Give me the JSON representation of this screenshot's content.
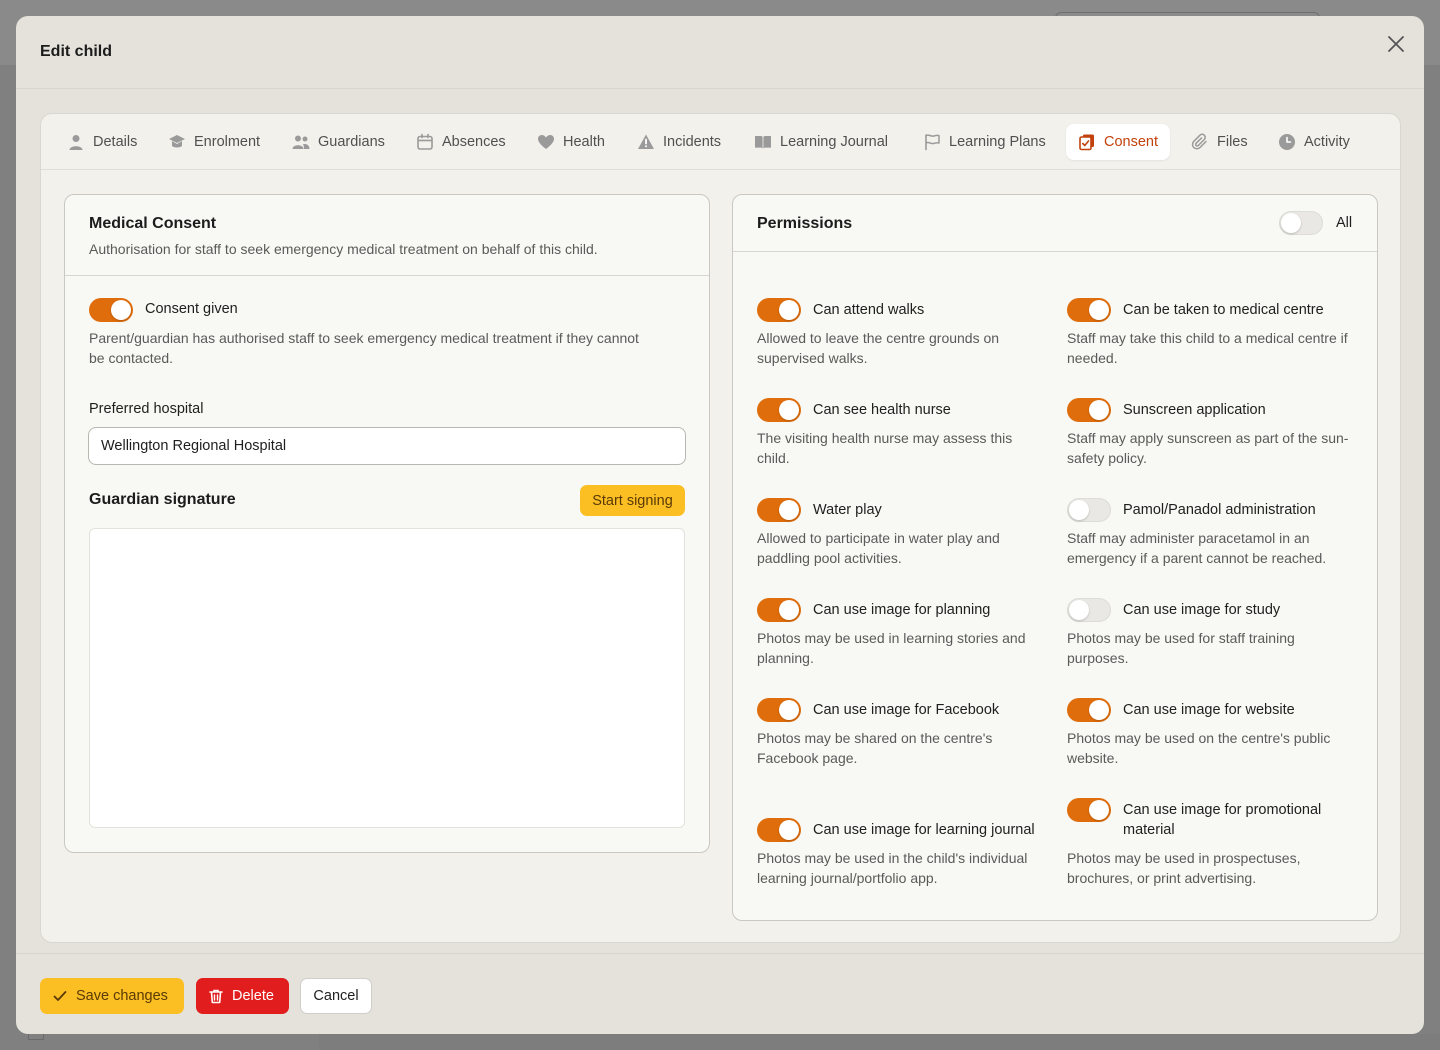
{
  "modal": {
    "title": "Edit child"
  },
  "tabs": [
    {
      "label": "Details",
      "icon": "user-icon"
    },
    {
      "label": "Enrolment",
      "icon": "graduation-cap-icon"
    },
    {
      "label": "Guardians",
      "icon": "users-icon"
    },
    {
      "label": "Absences",
      "icon": "calendar-icon"
    },
    {
      "label": "Health",
      "icon": "heart-icon"
    },
    {
      "label": "Incidents",
      "icon": "warning-triangle-icon"
    },
    {
      "label": "Learning Journal",
      "icon": "book-open-icon"
    },
    {
      "label": "Learning Plans",
      "icon": "flag-icon"
    },
    {
      "label": "Consent",
      "icon": "clipboard-check-icon",
      "active": true
    },
    {
      "label": "Files",
      "icon": "paperclip-icon"
    },
    {
      "label": "Activity",
      "icon": "clock-icon"
    }
  ],
  "medical": {
    "title": "Medical Consent",
    "subtitle": "Authorisation for staff to seek emergency medical treatment on behalf of this child.",
    "consent_label": "Consent given",
    "consent_on": true,
    "consent_desc_1": "Parent/guardian has authorised staff to seek emergency medical treatment if they cannot",
    "consent_desc_2": "be contacted.",
    "hospital_label": "Preferred hospital",
    "hospital_value": "Wellington Regional Hospital",
    "signature_title": "Guardian signature",
    "start_signing": "Start signing"
  },
  "permissions": {
    "title": "Permissions",
    "all_label": "All",
    "all_on": false,
    "items": [
      {
        "label": "Can attend walks",
        "desc": "Allowed to leave the centre grounds on supervised walks.",
        "on": true
      },
      {
        "label": "Can be taken to medical centre",
        "desc": "Staff may take this child to a medical centre if needed.",
        "on": true
      },
      {
        "label": "Can see health nurse",
        "desc": "The visiting health nurse may assess this child.",
        "on": true
      },
      {
        "label": "Sunscreen application",
        "desc": "Staff may apply sunscreen as part of the sun-safety policy.",
        "on": true
      },
      {
        "label": "Water play",
        "desc": "Allowed to participate in water play and paddling pool activities.",
        "on": true
      },
      {
        "label": "Pamol/Panadol administration",
        "desc": "Staff may administer paracetamol in an emergency if a parent cannot be reached.",
        "on": false
      },
      {
        "label": "Can use image for planning",
        "desc": "Photos may be used in learning stories and planning.",
        "on": true
      },
      {
        "label": "Can use image for study",
        "desc": "Photos may be used for staff training purposes.",
        "on": false
      },
      {
        "label": "Can use image for Facebook",
        "desc": "Photos may be shared on the centre's Facebook page.",
        "on": true
      },
      {
        "label": "Can use image for website",
        "desc": "Photos may be used on the centre's public website.",
        "on": true
      },
      {
        "label": "Can use image for learning journal",
        "desc": "Photos may be used in the child's individual learning journal/portfolio app.",
        "on": true
      },
      {
        "label": "Can use image for promotional material",
        "desc": "Photos may be used in prospectuses, brochures, or print advertising.",
        "on": true
      }
    ]
  },
  "footer": {
    "save": "Save changes",
    "delete": "Delete",
    "cancel": "Cancel"
  },
  "colors": {
    "accent": "#e06d0b",
    "primary_button": "#fbbf24",
    "danger": "#e11d1d",
    "active_tab_text": "#c2410c"
  }
}
